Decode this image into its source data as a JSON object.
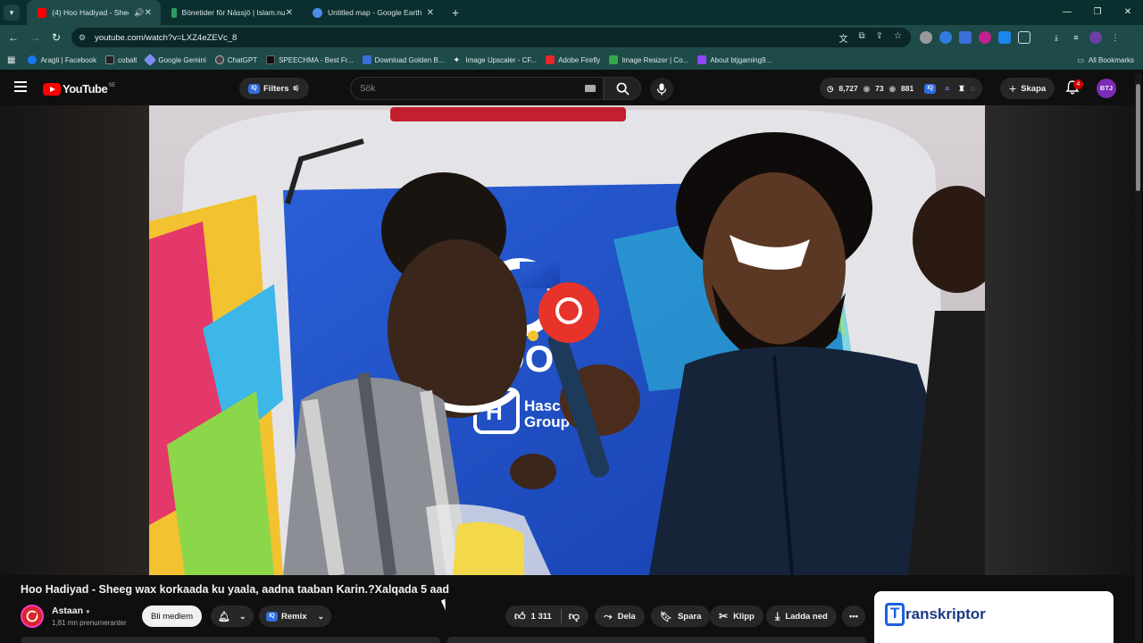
{
  "browser": {
    "tabs": [
      {
        "title": "(4) Hoo Hadiyad - Sheeg w",
        "favicon_color": "#ff0000",
        "active": true
      },
      {
        "title": "Bönetider för Nässjö | Islam.nu",
        "favicon_color": "#2f9a60",
        "active": false
      },
      {
        "title": "Untitled map - Google Earth",
        "favicon_color": "#4a8ee8",
        "active": false
      }
    ],
    "new_tab_glyph": "+",
    "url": "youtube.com/watch?v=LXZ4eZEVc_8",
    "bookmarks": [
      {
        "label": "Aragti | Facebook",
        "color": "#1877f2"
      },
      {
        "label": "cobalt",
        "color": "#222222"
      },
      {
        "label": "Google Gemini",
        "color": "#7c8cf0"
      },
      {
        "label": "ChatGPT",
        "color": "#444444"
      },
      {
        "label": "SPEECHMA - Best Fr...",
        "color": "#111111"
      },
      {
        "label": "Download Golden B...",
        "color": "#3a6ed8"
      },
      {
        "label": "Image Upscaler - CF...",
        "color": "#222222"
      },
      {
        "label": "Adobe Firefly",
        "color": "#e8242c"
      },
      {
        "label": "Image Resizer | Co...",
        "color": "#37a84a"
      },
      {
        "label": "About btjgaming9...",
        "color": "#9146ff"
      }
    ],
    "all_bookmarks": "All Bookmarks"
  },
  "youtube": {
    "logo_text": "YouTube",
    "country": "SE",
    "filters_label": "Filters",
    "search_placeholder": "Sök",
    "stats": {
      "views": "8,727",
      "likes": "73",
      "watch": "881"
    },
    "create_label": "Skapa",
    "notifications_count": "4",
    "avatar_initials": "BTJ"
  },
  "video": {
    "title": "Hoo Hadiyad - Sheeg wax korkaada ku yaala, aadna taaban Karin.?Xalqada 5 aad",
    "channel_name": "Astaan",
    "subscribers": "1,81 mn prenumeranter",
    "join_label": "Bli medlem",
    "remix_label": "Remix",
    "like_count": "1 311",
    "share_label": "Dela",
    "save_label": "Spara",
    "clip_label": "Klipp",
    "download_label": "Ladda ned",
    "van_brand": "GODO",
    "van_brand2_line1": "Hasco",
    "van_brand2_line2": "Group"
  },
  "overlay": {
    "transkriptor_label": "ranskriptor"
  },
  "colors": {
    "browser_frame": "#0b2e2e",
    "toolbar": "#1e4a4a",
    "youtube_bg": "#0f0f0f",
    "youtube_red": "#ff0000",
    "pill_bg": "#272727"
  }
}
